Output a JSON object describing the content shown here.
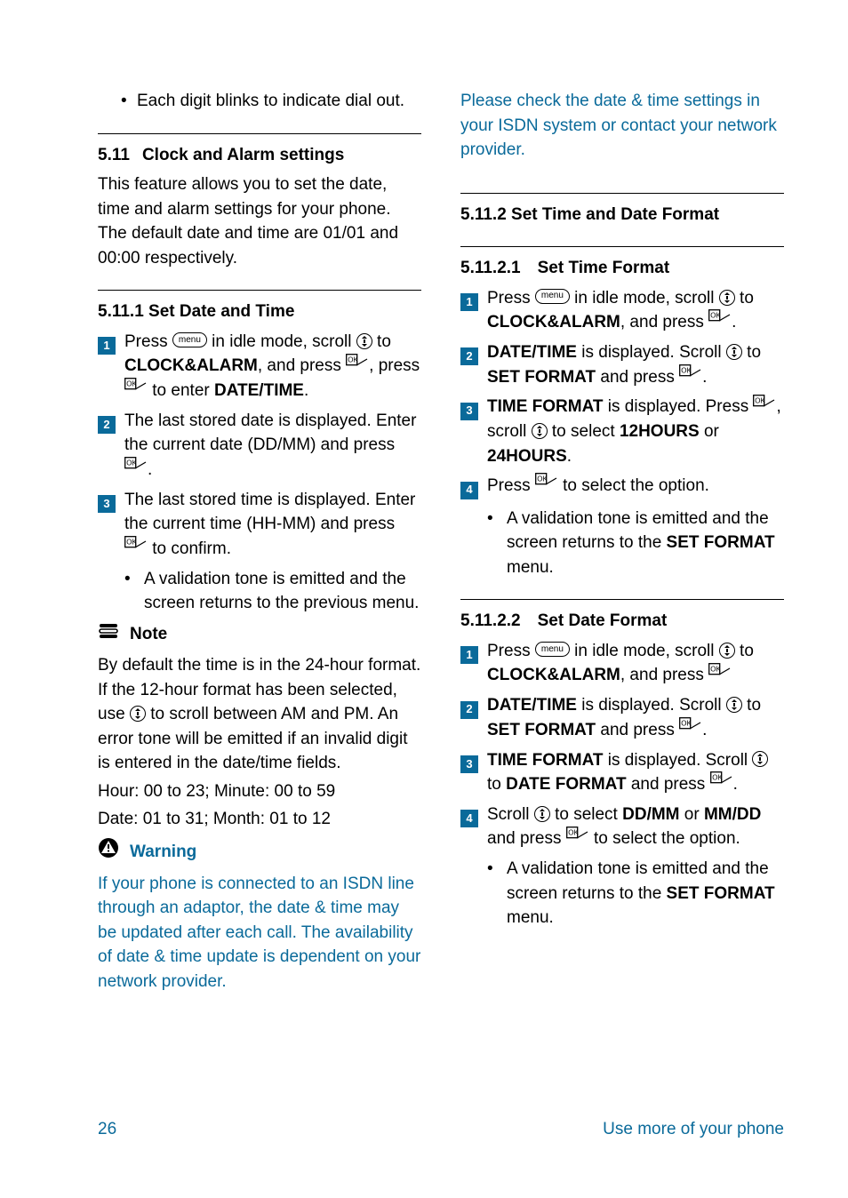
{
  "left": {
    "intro_bullet": "Each digit blinks to indicate dial out.",
    "s511": {
      "num": "5.11",
      "title": "Clock and Alarm settings",
      "body": "This feature allows you to set the date, time and alarm settings for your phone. The default date and time are 01/01 and 00:00 respectively."
    },
    "s5111": {
      "title": "5.11.1 Set Date and Time",
      "steps": {
        "s1a": "Press ",
        "s1b": " in idle mode, scroll ",
        "s1c": " to ",
        "s1_bold1": "CLOCK&ALARM",
        "s1d": ", and press ",
        "s1e": ", press ",
        "s1f": " to enter ",
        "s1_bold2": "DATE/TIME",
        "s1g": ".",
        "s2a": "The last stored date is displayed. Enter the current date (DD/MM) and press ",
        "s2b": ".",
        "s3a": "The last stored time is displayed. Enter the current time (HH-MM) and press ",
        "s3b": " to confirm.",
        "s3_bullet": "A validation tone is emitted and the screen returns to the previous menu."
      }
    },
    "note": {
      "label": "Note",
      "body1": "By default the time is in the 24-hour format. If the 12-hour format has been selected, use ",
      "body2": " to scroll between AM and PM. An error tone will be emitted if an invalid digit is entered in the date/time fields.",
      "hour": "Hour: 00 to 23; Minute: 00 to 59",
      "date": "Date: 01 to 31; Month: 01 to 12"
    },
    "warning": {
      "label": "Warning",
      "body": "If your phone is connected to an ISDN line through an adaptor, the date & time may be updated after each call. The availability of date & time update is dependent on your network provider. "
    }
  },
  "right": {
    "warning_cont": "Please check the date & time settings in your ISDN system or contact your network provider.",
    "s5112": {
      "title": "5.11.2 Set Time and Date Format"
    },
    "s51121": {
      "title": "5.11.2.1 Set Time Format",
      "s1a": "Press ",
      "s1b": " in idle mode, scroll ",
      "s1c": " to ",
      "s1_bold1": "CLOCK&ALARM",
      "s1d": ", and press ",
      "s1e": ".",
      "s2_bold1": "DATE/TIME",
      "s2a": " is displayed. Scroll ",
      "s2b": " to ",
      "s2_bold2": "SET FORMAT",
      "s2c": " and press ",
      "s2d": ".",
      "s3_bold1": "TIME FORMAT",
      "s3a": " is displayed. Press ",
      "s3b": ", scroll ",
      "s3c": " to select ",
      "s3_bold2": "12HOURS",
      "s3d": " or ",
      "s3_bold3": "24HOURS",
      "s3e": ".",
      "s4a": "Press ",
      "s4b": " to select the option.",
      "s4_bullet_a": "A validation tone is emitted and the screen returns to the ",
      "s4_bullet_bold": "SET FORMAT",
      "s4_bullet_b": " menu."
    },
    "s51122": {
      "title": "5.11.2.2 Set Date Format",
      "s1a": "Press ",
      "s1b": " in idle mode, scroll ",
      "s1c": " to ",
      "s1_bold1": "CLOCK&ALARM",
      "s1d": ", and press ",
      "s2_bold1": "DATE/TIME",
      "s2a": " is displayed. Scroll ",
      "s2b": " to ",
      "s2_bold2": "SET FORMAT",
      "s2c": " and press ",
      "s2d": ".",
      "s3_bold1": "TIME FORMAT",
      "s3a": " is displayed. Scroll ",
      "s3b": " to ",
      "s3_bold2": "DATE FORMAT",
      "s3c": " and press ",
      "s3d": ".",
      "s4a": "Scroll ",
      "s4b": " to select ",
      "s4_bold1": "DD/MM",
      "s4c": " or ",
      "s4_bold2": "MM/DD",
      "s4d": " and press ",
      "s4e": " to select the option.",
      "s4_bullet_a": "A validation tone is emitted and the screen returns to the ",
      "s4_bullet_bold": "SET FORMAT",
      "s4_bullet_b": " menu."
    }
  },
  "icons": {
    "menu": "menu"
  },
  "footer": {
    "page": "26",
    "title": "Use more of your phone"
  },
  "step_nums": {
    "n1": "1",
    "n2": "2",
    "n3": "3",
    "n4": "4"
  }
}
